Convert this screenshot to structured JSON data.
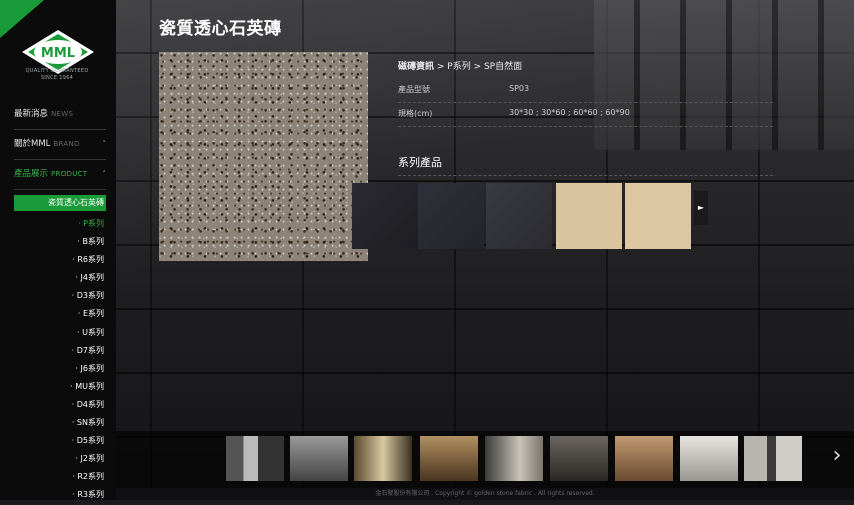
{
  "logo": {
    "text": "MML",
    "tagline": "QUALITY GUARANTEED",
    "since": "SINCE 1964"
  },
  "nav": [
    {
      "label": "最新消息",
      "en": "NEWS"
    },
    {
      "label": "關於MML",
      "en": "BRAND",
      "chevron": "˅"
    },
    {
      "label": "產品展示",
      "en": "PRODUCT",
      "chevron": "˄"
    }
  ],
  "sub_active": "瓷質透心石英磚",
  "series": [
    "· P系列",
    "· B系列",
    "· R6系列",
    "· J4系列",
    "· D3系列",
    "· E系列",
    "· U系列",
    "· D7系列",
    "· J6系列",
    "· MU系列",
    "· D4系列",
    "· SN系列",
    "· D5系列",
    "· J2系列",
    "· R2系列",
    "· R3系列"
  ],
  "page_title": "瓷質透心石英磚",
  "breadcrumb": {
    "main": "磁磚資訊",
    "rest": " > P系列 > SP自然面"
  },
  "info": [
    {
      "label": "產品型號",
      "value": "SP03"
    },
    {
      "label": "規格(cm)",
      "value": "30*30 ; 30*60 ; 60*60 ; 60*90"
    }
  ],
  "series_title": "系列產品",
  "next_icon": "►",
  "strip_next_icon": "›",
  "footer": "金石發股份有限公司 . Copyright © golden stone fabric . All rights reserved."
}
